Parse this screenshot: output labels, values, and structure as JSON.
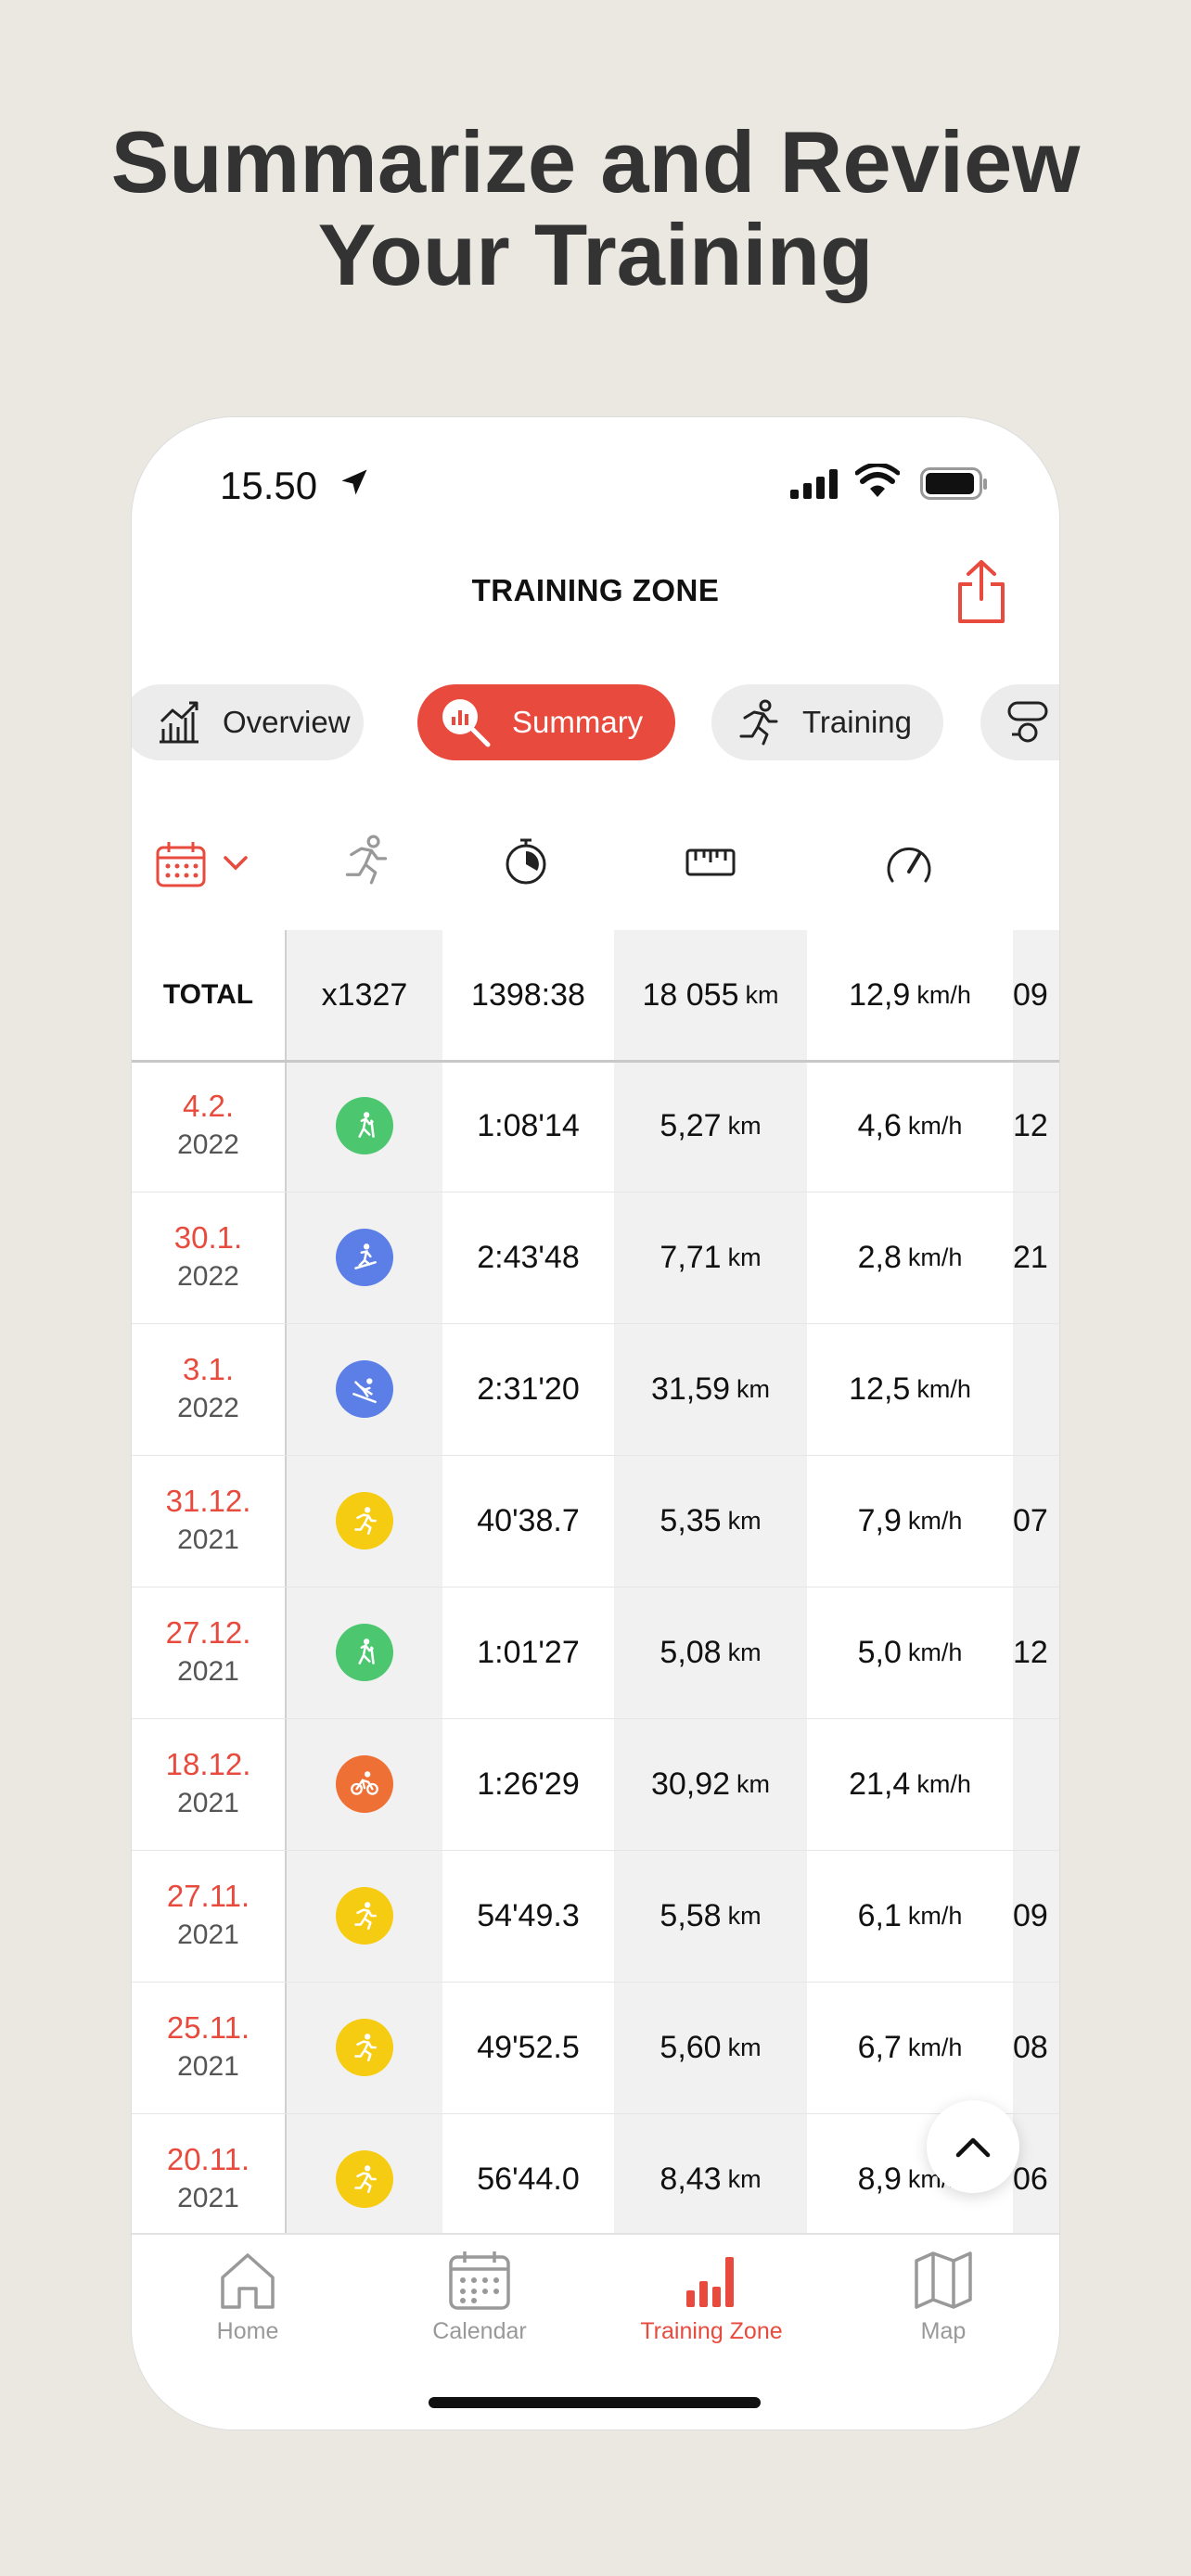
{
  "headline": {
    "line1": "Summarize and Review",
    "line2": "Your Training"
  },
  "status_bar": {
    "time": "15.50"
  },
  "nav": {
    "title": "TRAINING ZONE"
  },
  "tabs": [
    {
      "label": "Overview",
      "icon": "chart-line-icon"
    },
    {
      "label": "Summary",
      "icon": "summary-magnifier-icon",
      "active": true
    },
    {
      "label": "Training",
      "icon": "running-person-icon"
    }
  ],
  "totals": {
    "label": "TOTAL",
    "count": "x1327",
    "duration": "1398:38",
    "distance": "18 055",
    "distance_unit": "km",
    "speed": "12,9",
    "speed_unit": "km/h",
    "extra": "09"
  },
  "rows": [
    {
      "day": "4.2.",
      "year": "2022",
      "sport": "hiking",
      "color": "#4cc770",
      "duration": "1:08'14",
      "distance": "5,27",
      "speed": "4,6",
      "extra": "12"
    },
    {
      "day": "30.1.",
      "year": "2022",
      "sport": "skitouring",
      "color": "#5b7fe6",
      "duration": "2:43'48",
      "distance": "7,71",
      "speed": "2,8",
      "extra": "21"
    },
    {
      "day": "3.1.",
      "year": "2022",
      "sport": "downhill-skiing",
      "color": "#5b7fe6",
      "duration": "2:31'20",
      "distance": "31,59",
      "speed": "12,5",
      "extra": ""
    },
    {
      "day": "31.12.",
      "year": "2021",
      "sport": "running",
      "color": "#f5cc12",
      "duration": "40'38.7",
      "distance": "5,35",
      "speed": "7,9",
      "extra": "07"
    },
    {
      "day": "27.12.",
      "year": "2021",
      "sport": "hiking",
      "color": "#4cc770",
      "duration": "1:01'27",
      "distance": "5,08",
      "speed": "5,0",
      "extra": "12"
    },
    {
      "day": "18.12.",
      "year": "2021",
      "sport": "cycling",
      "color": "#ef7035",
      "duration": "1:26'29",
      "distance": "30,92",
      "speed": "21,4",
      "extra": ""
    },
    {
      "day": "27.11.",
      "year": "2021",
      "sport": "running",
      "color": "#f5cc12",
      "duration": "54'49.3",
      "distance": "5,58",
      "speed": "6,1",
      "extra": "09"
    },
    {
      "day": "25.11.",
      "year": "2021",
      "sport": "running",
      "color": "#f5cc12",
      "duration": "49'52.5",
      "distance": "5,60",
      "speed": "6,7",
      "extra": "08"
    },
    {
      "day": "20.11.",
      "year": "2021",
      "sport": "running",
      "color": "#f5cc12",
      "duration": "56'44.0",
      "distance": "8,43",
      "speed": "8,9",
      "extra": "06"
    }
  ],
  "units": {
    "distance": "km",
    "speed": "km/h"
  },
  "tabbar": [
    {
      "label": "Home",
      "icon": "home-icon"
    },
    {
      "label": "Calendar",
      "icon": "calendar-icon"
    },
    {
      "label": "Training Zone",
      "icon": "bar-chart-icon",
      "active": true
    },
    {
      "label": "Map",
      "icon": "map-icon"
    }
  ],
  "colors": {
    "accent": "#e84a3d",
    "background": "#ebe8e2",
    "hiking": "#4cc770",
    "skiing": "#5b7fe6",
    "running": "#f5cc12",
    "cycling": "#ef7035"
  }
}
